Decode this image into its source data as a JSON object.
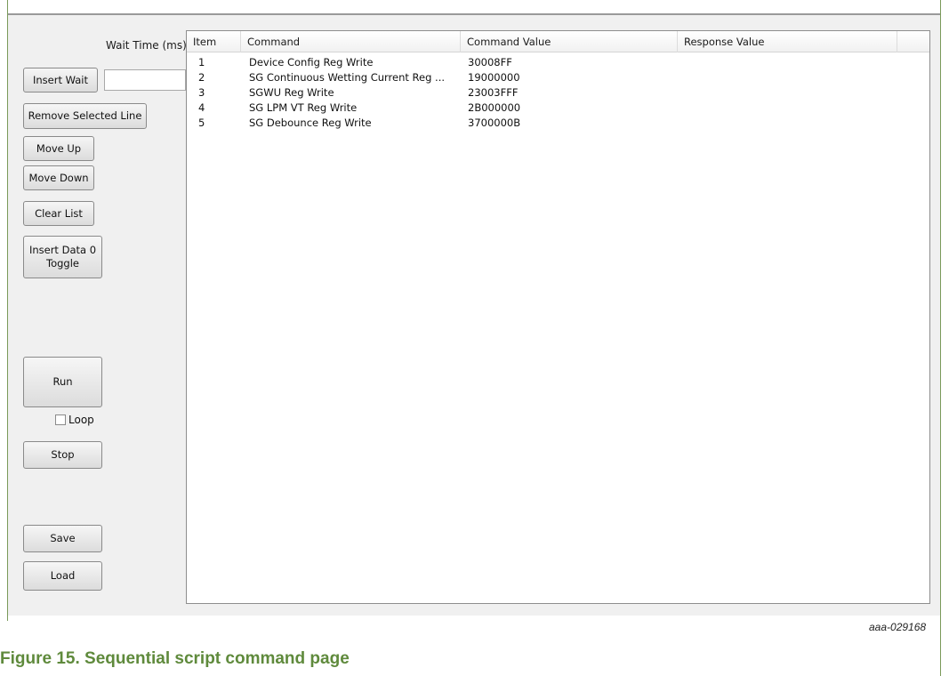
{
  "panel": {
    "wait_label": "Wait Time (ms)",
    "wait_value": "",
    "buttons": {
      "insert_wait": "Insert Wait",
      "remove_selected": "Remove Selected Line",
      "move_up": "Move Up",
      "move_down": "Move Down",
      "clear_list": "Clear List",
      "insert_toggle": "Insert Data 0\nToggle",
      "run": "Run",
      "stop": "Stop",
      "save": "Save",
      "load": "Load"
    },
    "loop_label": "Loop",
    "loop_checked": false
  },
  "table": {
    "columns": [
      "Item",
      "Command",
      "Command Value",
      "Response Value"
    ],
    "rows": [
      {
        "item": "1",
        "command": "Device Config Reg Write",
        "value": "30008FF",
        "response": ""
      },
      {
        "item": "2",
        "command": "SG Continuous Wetting Current Reg ...",
        "value": "19000000",
        "response": ""
      },
      {
        "item": "3",
        "command": "SGWU Reg Write",
        "value": "23003FFF",
        "response": ""
      },
      {
        "item": "4",
        "command": "SG LPM VT Reg Write",
        "value": "2B000000",
        "response": ""
      },
      {
        "item": "5",
        "command": "SG Debounce Reg Write",
        "value": "3700000B",
        "response": ""
      }
    ]
  },
  "figure": {
    "id": "aaa-029168",
    "caption": "Figure 15.  Sequential script command page"
  }
}
